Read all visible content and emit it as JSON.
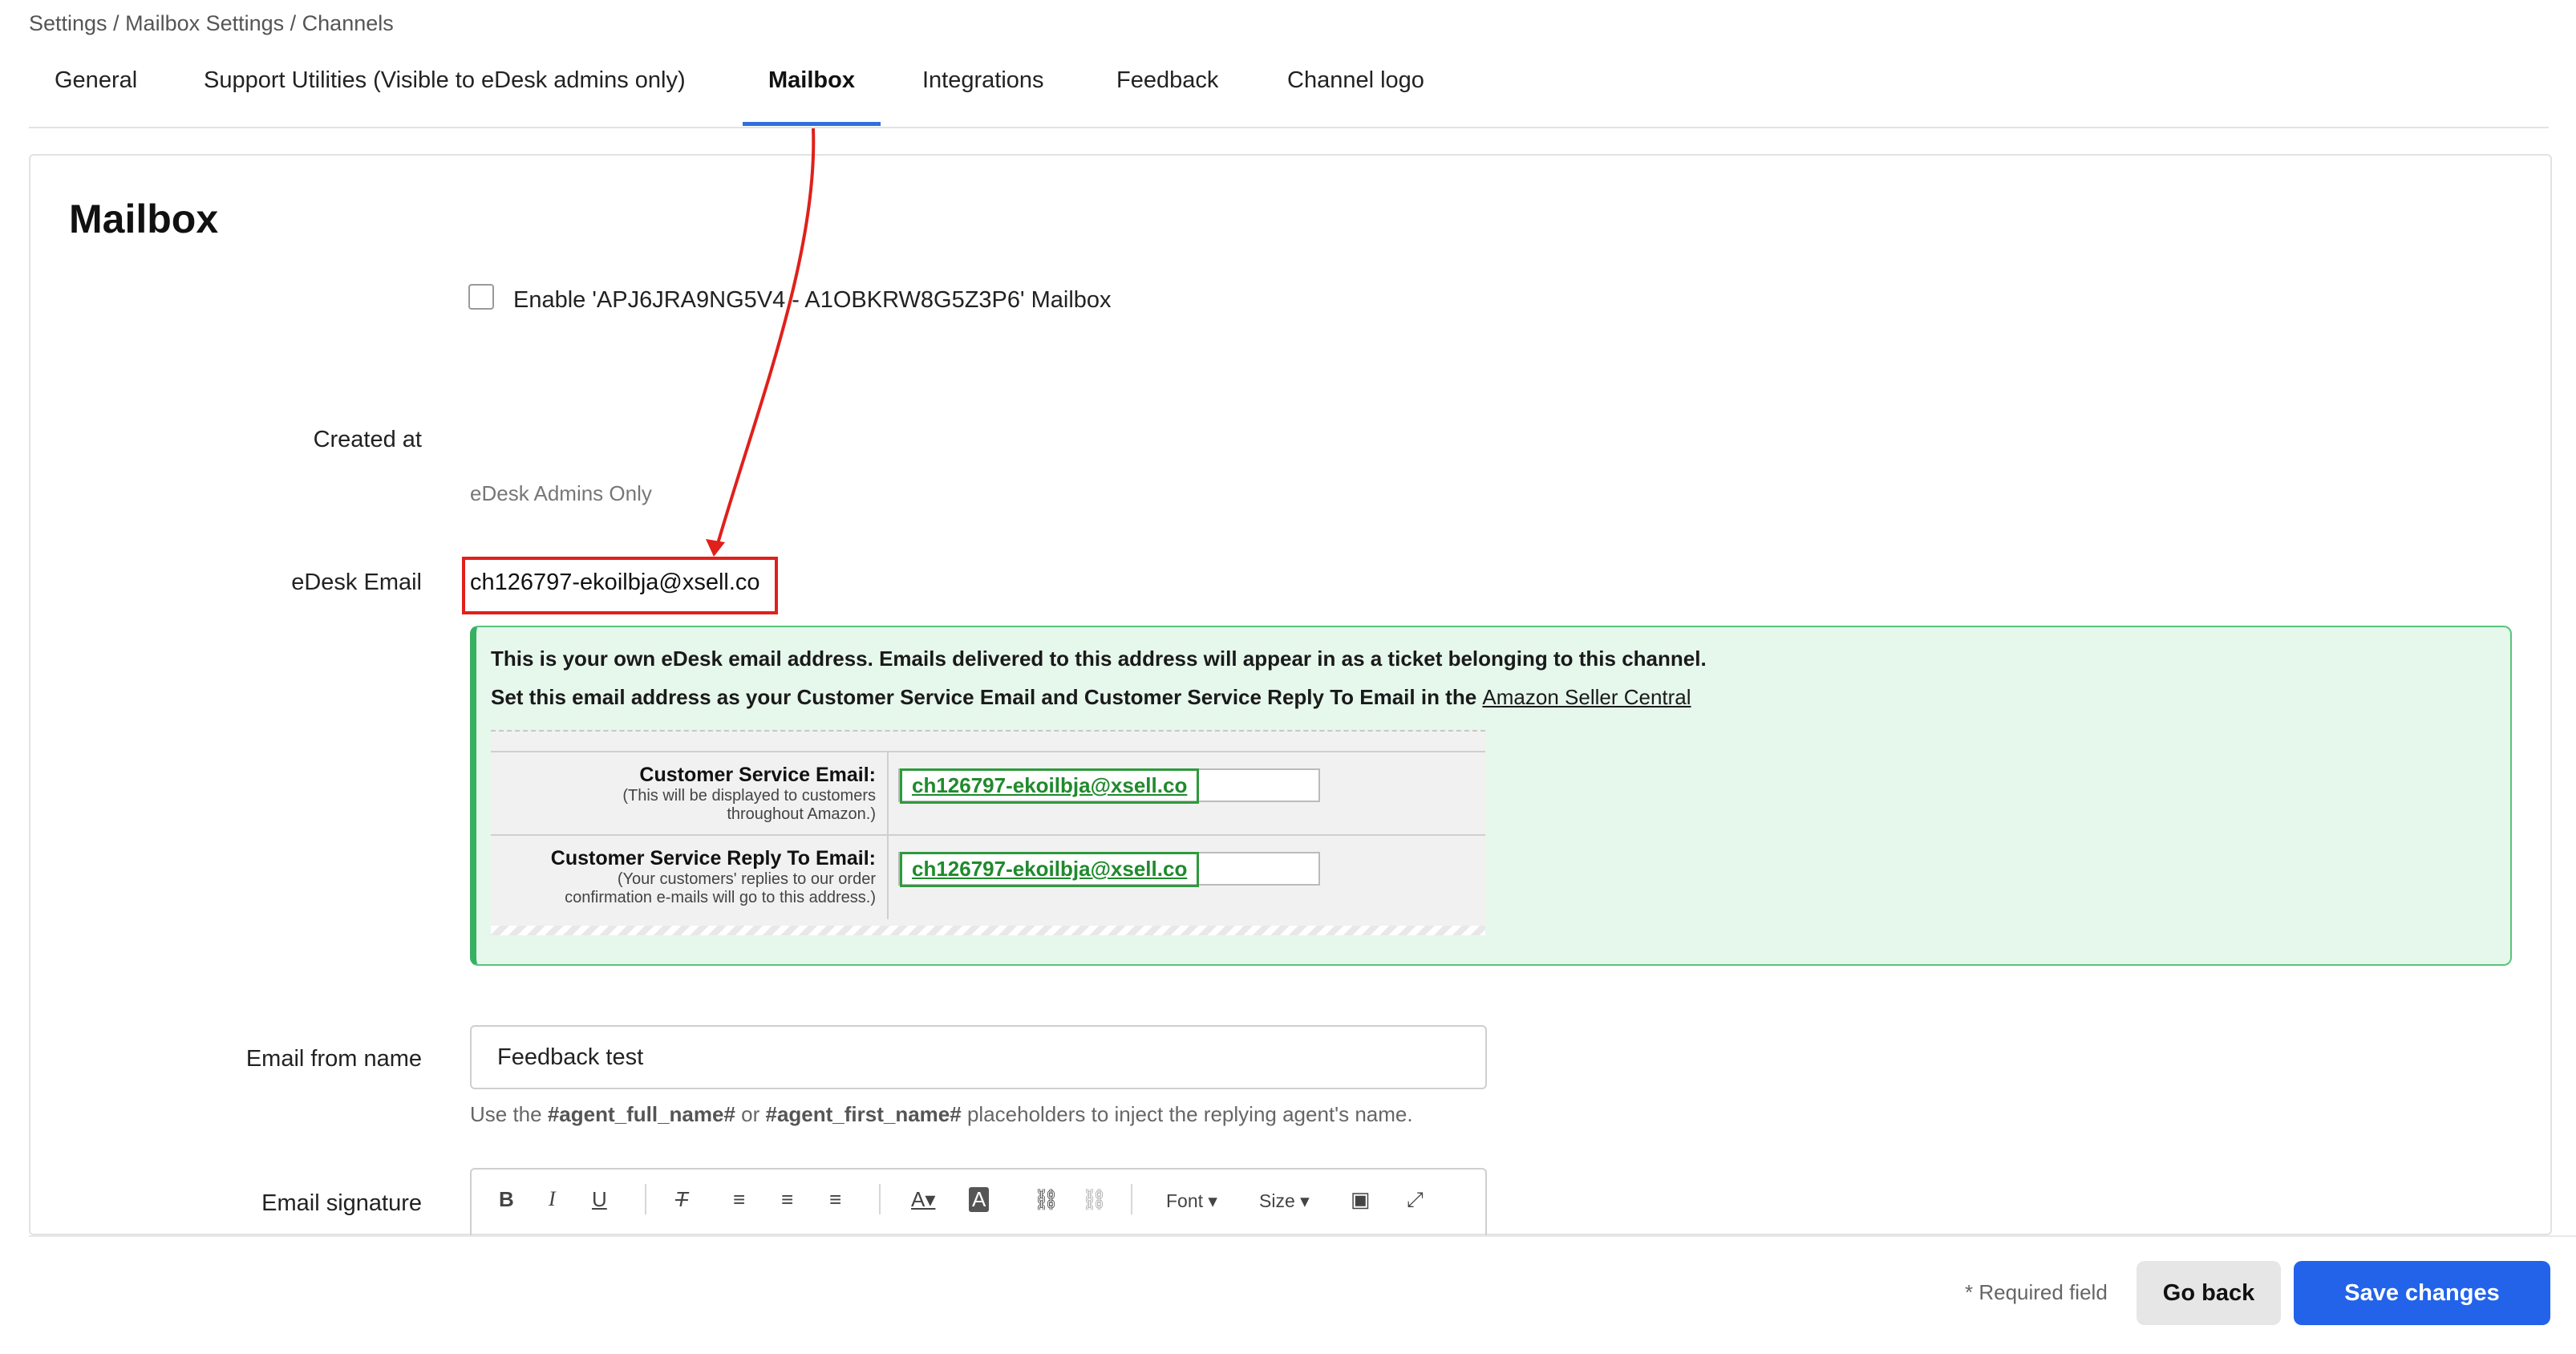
{
  "breadcrumb": "Settings / Mailbox Settings / Channels",
  "tabs": [
    {
      "label": "General"
    },
    {
      "label": "Support Utilities (Visible to eDesk admins only)"
    },
    {
      "label": "Mailbox",
      "active": true
    },
    {
      "label": "Integrations"
    },
    {
      "label": "Feedback"
    },
    {
      "label": "Channel logo"
    }
  ],
  "section_title": "Mailbox",
  "enable_checkbox": {
    "label": "Enable 'APJ6JRA9NG5V4 - A1OBKRW8G5Z3P6' Mailbox",
    "checked": false
  },
  "created_at": {
    "label": "Created at",
    "note": "eDesk Admins Only"
  },
  "edesk_email": {
    "label": "eDesk Email",
    "value": "ch126797-ekoilbja@xsell.co"
  },
  "info_box": {
    "line1": "This is your own eDesk email address. Emails delivered to this address will appear in as a ticket belonging to this channel.",
    "line2_prefix": "Set this email address as your Customer Service Email and Customer Service Reply To Email in the ",
    "line2_link": "Amazon Seller Central"
  },
  "amazon_form": {
    "rows": [
      {
        "title": "Customer Service Email:",
        "sub1": "(This will be displayed to customers",
        "sub2": "throughout Amazon.)",
        "value": "ch126797-ekoilbja@xsell.co"
      },
      {
        "title": "Customer Service Reply To Email:",
        "sub1": "(Your customers' replies to our order",
        "sub2": "confirmation e-mails will go to this address.)",
        "value": "ch126797-ekoilbja@xsell.co"
      }
    ]
  },
  "email_from_name": {
    "label": "Email from name",
    "value": "Feedback test",
    "hint_prefix": "Use the ",
    "hint_ph1": "#agent_full_name#",
    "hint_mid": " or ",
    "hint_ph2": "#agent_first_name#",
    "hint_suffix": " placeholders to inject the replying agent's name."
  },
  "email_signature": {
    "label": "Email signature",
    "toolbar": {
      "font": "Font",
      "size": "Size"
    }
  },
  "footer": {
    "required_note": "* Required field",
    "go_back": "Go back",
    "save": "Save changes"
  },
  "colors": {
    "accent": "#2263e9",
    "annotation_red": "#e0201b",
    "info_green": "#38b062"
  }
}
